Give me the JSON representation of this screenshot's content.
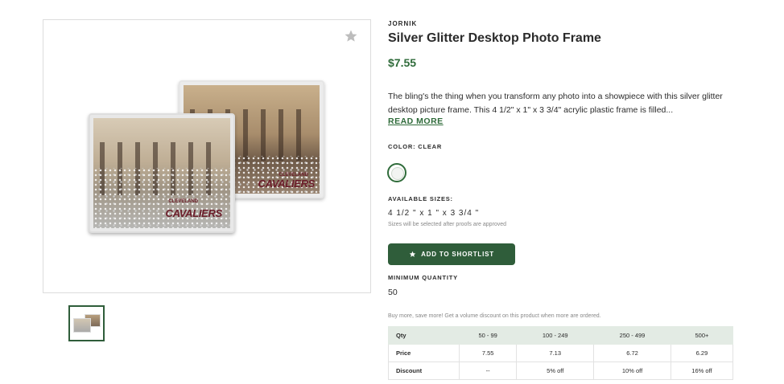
{
  "product": {
    "brand": "JORNIK",
    "title": "Silver Glitter Desktop Photo Frame",
    "price": "$7.55",
    "description": "The bling's the thing when you transform any photo into a showpiece with this silver glitter desktop picture frame. This 4 1/2\" x 1\" x 3 3/4\" acrylic plastic frame is filled...",
    "read_more": "READ MORE",
    "favorite_icon": "star-icon"
  },
  "image": {
    "front_small": "CLEVELAND",
    "front_big": "CAVALIERS",
    "back_small": "CLEVELAND",
    "back_big": "CAVALIERS"
  },
  "color": {
    "label": "COLOR: CLEAR",
    "swatch_color": "#f2f4f2"
  },
  "sizes": {
    "label": "AVAILABLE SIZES:",
    "value": "4 1/2 \" x 1 \" x 3 3/4 \"",
    "note": "Sizes will be selected after proofs are approved"
  },
  "shortlist": {
    "label": "ADD TO SHORTLIST",
    "icon": "star-icon",
    "color": "#2f5d3a"
  },
  "minimum": {
    "label": "MINIMUM QUANTITY",
    "value": "50"
  },
  "volume_note": "Buy more, save more! Get a volume discount on this product when more are ordered.",
  "pricing_table": {
    "header": [
      "Qty",
      "50 - 99",
      "100 - 249",
      "250 - 499",
      "500+"
    ],
    "rows": [
      [
        "Price",
        "7.55",
        "7.13",
        "6.72",
        "6.29"
      ],
      [
        "Discount",
        "--",
        "5% off",
        "10% off",
        "16% off"
      ]
    ]
  },
  "colors": {
    "accent": "#2f6b3a",
    "button": "#2f5d3a",
    "table_header": "#e3ebe4"
  }
}
